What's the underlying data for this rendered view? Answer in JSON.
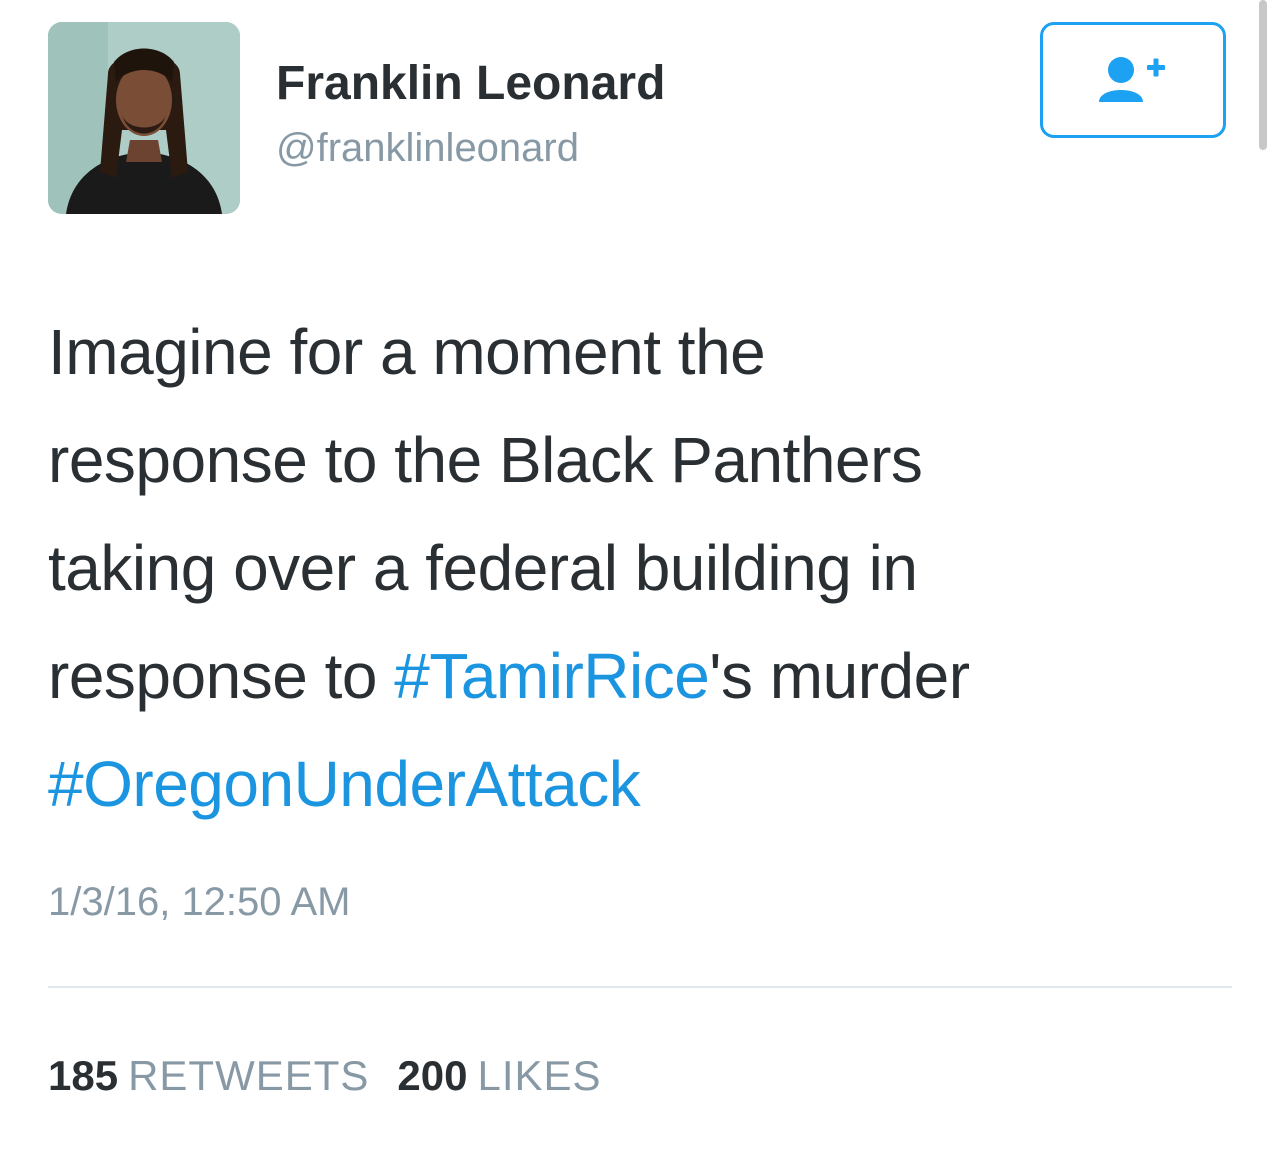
{
  "user": {
    "display_name": "Franklin Leonard",
    "handle": "@franklinleonard"
  },
  "follow_button": {
    "icon": "add-user-icon",
    "color": "#1da1f2"
  },
  "tweet": {
    "line1": "Imagine for a moment the",
    "line2": "response to the Black Panthers",
    "line3": "taking over a federal building in",
    "line4_before": "response to ",
    "hashtag1": "#TamirRice",
    "line4_after": "'s murder",
    "hashtag2": "#OregonUnderAttack",
    "timestamp": "1/3/16, 12:50 AM"
  },
  "stats": {
    "retweets_count": "185",
    "retweets_label": "RETWEETS",
    "likes_count": "200",
    "likes_label": "LIKES"
  },
  "colors": {
    "text": "#292f33",
    "secondary": "#8899a6",
    "hashtag": "#1b95e0",
    "divider": "#e1e8ed"
  }
}
